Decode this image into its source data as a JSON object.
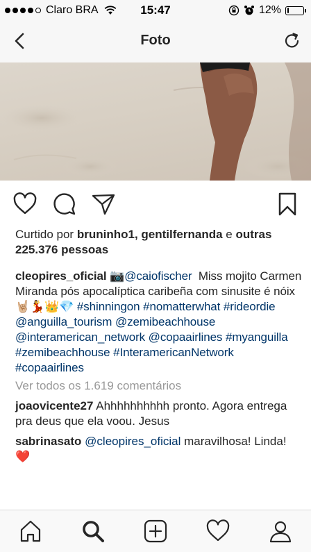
{
  "status_bar": {
    "carrier": "Claro BRA",
    "time": "15:47",
    "battery": "12%",
    "battery_level": 0.12
  },
  "nav": {
    "title": "Foto",
    "back_icon": "chevron-left-icon",
    "refresh_icon": "refresh-icon"
  },
  "actions": {
    "like_icon": "heart-outline-icon",
    "comment_icon": "speech-bubble-icon",
    "share_icon": "paper-plane-icon",
    "save_icon": "bookmark-icon"
  },
  "likes": {
    "prefix": "Curtido por",
    "user1": "bruninho1",
    "user2": "gentilfernanda",
    "connector": "e",
    "others": "outras 225.376 pessoas"
  },
  "caption": {
    "author": "cleopires_oficial",
    "camera_emoji": "📷",
    "mention": "@caiofischer",
    "text": "Miss mojito Carmen Miranda pós apocalíptica caribeña com sinusite é nóix",
    "emojis": "🤘🏼💃👑💎",
    "tags": [
      "#shinningon",
      "#nomatterwhat",
      "#rideordie",
      "@anguilla_tourism",
      "@zemibeachhouse",
      "@interamerican_network",
      "@copaairlines",
      "#myanguilla",
      "#zemibeachhouse",
      "#InteramericanNetwork",
      "#copaairlines"
    ]
  },
  "view_all": "Ver todos os 1.619 comentários",
  "comments": [
    {
      "user": "joaovicente27",
      "text": "Ahhhhhhhhhh pronto. Agora entrega pra deus que ela voou. Jesus"
    },
    {
      "user": "sabrinasato",
      "mention": "@cleopires_oficial",
      "text": "maravilhosa! Linda!",
      "emoji": "❤️"
    }
  ],
  "tab_bar": {
    "items": [
      "home-icon",
      "search-icon",
      "add-icon",
      "activity-heart-icon",
      "profile-icon"
    ],
    "active": "search-icon"
  }
}
